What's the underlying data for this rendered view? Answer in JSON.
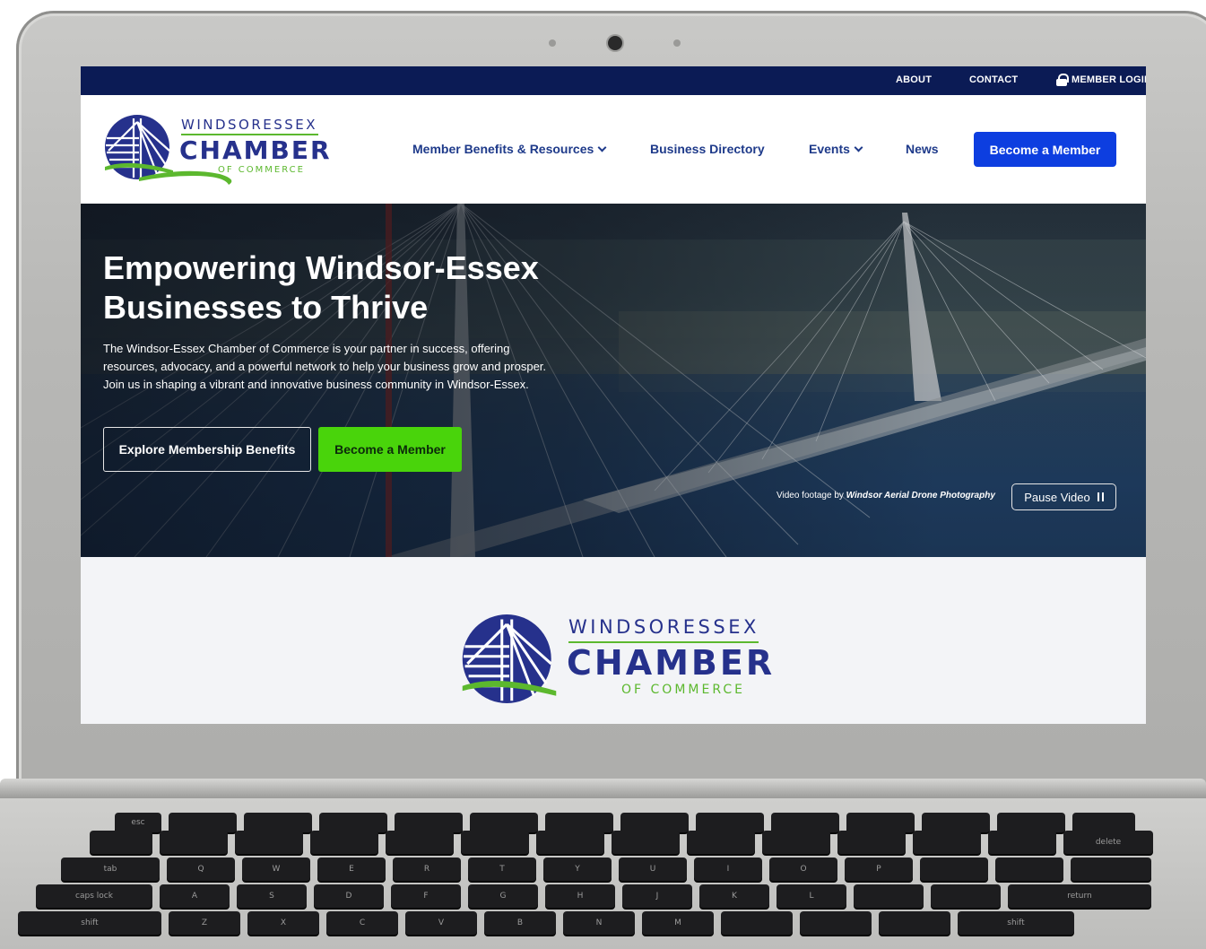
{
  "topbar": {
    "about": "ABOUT",
    "contact": "CONTACT",
    "login": "MEMBER LOGIN"
  },
  "logo": {
    "line1": "WINDSORESSEX",
    "line2": "CHAMBER",
    "line3": "OF COMMERCE"
  },
  "nav": {
    "items": [
      {
        "label": "Member Benefits & Resources",
        "has_dropdown": true
      },
      {
        "label": "Business Directory",
        "has_dropdown": false
      },
      {
        "label": "Events",
        "has_dropdown": true
      },
      {
        "label": "News",
        "has_dropdown": false
      }
    ],
    "cta": "Become a Member"
  },
  "hero": {
    "title": "Empowering Windsor-Essex Businesses to Thrive",
    "description": "The Windsor-Essex Chamber of Commerce is your partner in success, offering resources, advocacy, and a powerful network to help your business grow and prosper. Join us in shaping a vibrant and innovative business community in Windsor-Essex.",
    "primary_button": "Explore Membership Benefits",
    "secondary_button": "Become a Member",
    "credit_prefix": "Video footage by",
    "credit_name": "Windsor Aerial Drone Photography",
    "pause_label": "Pause Video"
  },
  "colors": {
    "topbar": "#0b1b55",
    "nav_text": "#1e3a8a",
    "nav_cta": "#0d3ee0",
    "hero_green": "#49d40b",
    "logo_blue": "#26318c",
    "logo_green": "#5cb82e"
  },
  "icons": [
    "lock-icon",
    "chevron-down-icon",
    "pause-icon",
    "webcam-icon"
  ]
}
